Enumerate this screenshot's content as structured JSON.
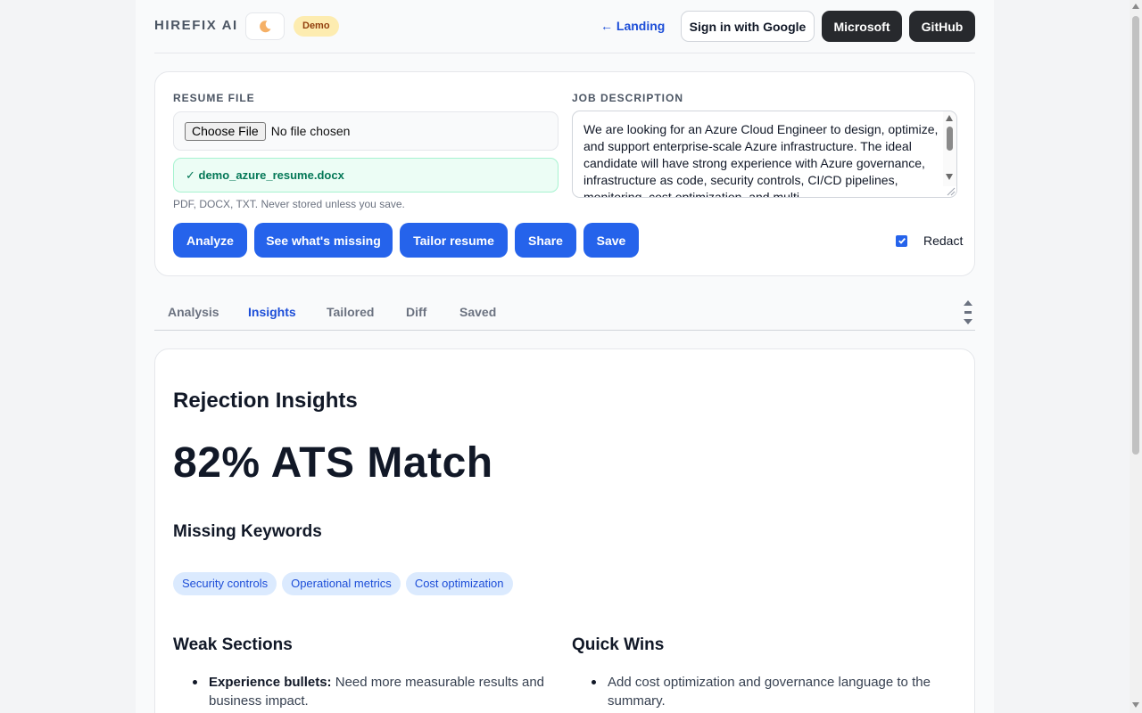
{
  "header": {
    "brand": "HIREFIX AI",
    "theme_icon": "crescent-moon-icon",
    "badge": "Demo",
    "landing_link": "← Landing",
    "sign_in_google": "Sign in with Google",
    "microsoft": "Microsoft",
    "github": "GitHub"
  },
  "resume": {
    "label": "RESUME FILE",
    "choose_file": "Choose File",
    "no_file": "No file chosen",
    "uploaded_file": "✓ demo_azure_resume.docx",
    "hint": "PDF, DOCX, TXT. Never stored unless you save."
  },
  "job": {
    "label": "JOB DESCRIPTION",
    "text": "We are looking for an Azure Cloud Engineer to design, optimize, and support enterprise-scale Azure infrastructure. The ideal candidate will have strong experience with Azure governance, infrastructure as code, security controls, CI/CD pipelines, monitoring, cost optimization, and multi-"
  },
  "actions": {
    "analyze": "Analyze",
    "missing": "See what's missing",
    "tailor": "Tailor resume",
    "share": "Share",
    "save": "Save",
    "redact_label": "Redact",
    "redact_checked": true
  },
  "tabs": {
    "analysis": "Analysis",
    "insights": "Insights",
    "tailored": "Tailored",
    "diff": "Diff",
    "saved": "Saved",
    "active": "Insights"
  },
  "insights": {
    "title": "Rejection Insights",
    "ats_match": "82% ATS Match",
    "missing_title": "Missing Keywords",
    "missing_keywords": [
      "Security controls",
      "Operational metrics",
      "Cost optimization"
    ],
    "weak_title": "Weak Sections",
    "weak_items": [
      {
        "label": "Experience bullets:",
        "text": "Need more measurable results and business impact."
      }
    ],
    "quick_title": "Quick Wins",
    "quick_items": [
      "Add cost optimization and governance language to the summary."
    ]
  },
  "colors": {
    "accent": "#2563eb",
    "link": "#1d4ed8",
    "dark_button": "#27292d",
    "success_bg": "#ecfdf5",
    "success_text": "#047857",
    "badge_bg": "#fdecb0",
    "chip_bg": "#dbeafe"
  }
}
